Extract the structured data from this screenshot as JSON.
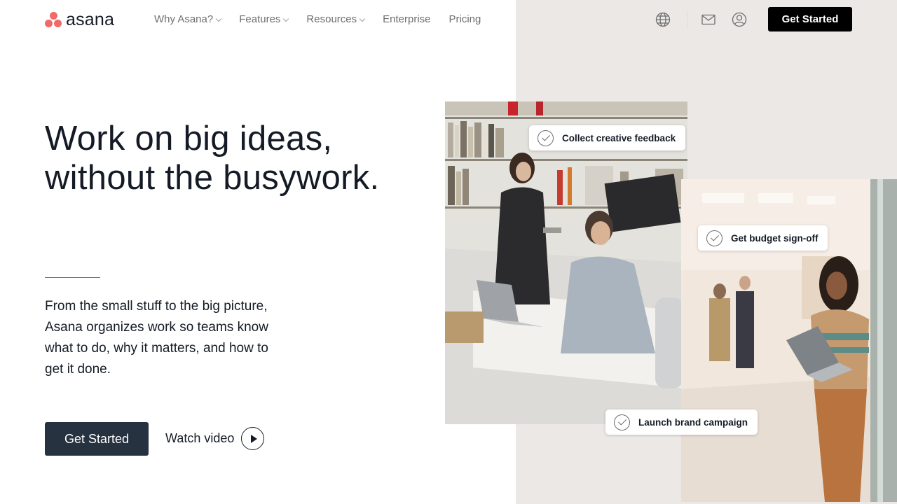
{
  "logo": {
    "text": "asana"
  },
  "nav": {
    "items": [
      {
        "label": "Why Asana?",
        "dropdown": true
      },
      {
        "label": "Features",
        "dropdown": true
      },
      {
        "label": "Resources",
        "dropdown": true
      },
      {
        "label": "Enterprise",
        "dropdown": false
      },
      {
        "label": "Pricing",
        "dropdown": false
      }
    ],
    "icons": [
      "globe-icon",
      "mail-icon",
      "user-icon"
    ],
    "cta_label": "Get Started"
  },
  "hero": {
    "title_line1": "Work on big ideas,",
    "title_line2": "without the busywork.",
    "description": "From the small stuff to the big picture, Asana organizes work so teams know what to do, why it matters, and how to get it done.",
    "primary_button": "Get Started",
    "watch_label": "Watch video"
  },
  "tasks": [
    {
      "label": "Collect creative feedback"
    },
    {
      "label": "Get budget sign-off"
    },
    {
      "label": "Launch brand campaign"
    }
  ],
  "colors": {
    "logo_coral": "#f06a6a",
    "primary_button": "#273240",
    "top_button": "#000000",
    "right_panel_bg": "#ece8e6",
    "text": "#151b26",
    "nav_text": "#6d6e6f"
  }
}
